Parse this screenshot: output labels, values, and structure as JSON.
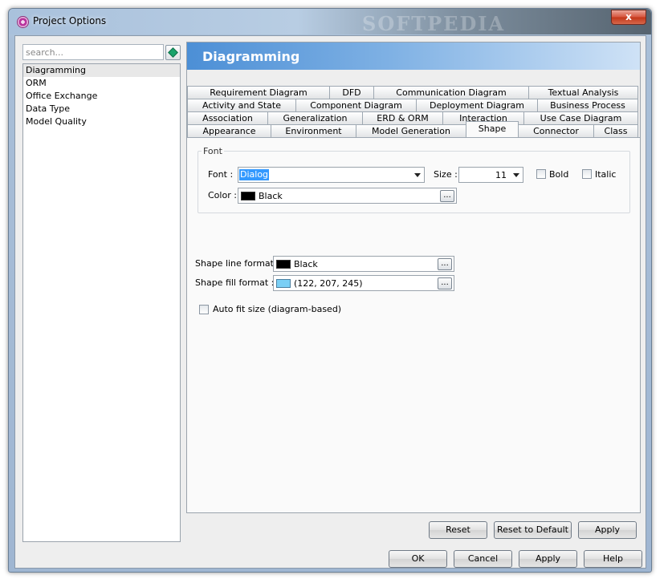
{
  "window": {
    "title": "Project Options",
    "watermark": "SOFTPEDIA",
    "close_label": "x"
  },
  "search": {
    "placeholder": "search..."
  },
  "nav": {
    "items": [
      "Diagramming",
      "ORM",
      "Office Exchange",
      "Data Type",
      "Model Quality"
    ],
    "selected": "Diagramming"
  },
  "header": {
    "title": "Diagramming"
  },
  "tabs": {
    "row1": [
      "Requirement Diagram",
      "DFD",
      "Communication Diagram",
      "Textual Analysis"
    ],
    "row2": [
      "Activity and State",
      "Component Diagram",
      "Deployment Diagram",
      "Business Process"
    ],
    "row3": [
      "Association",
      "Generalization",
      "ERD & ORM",
      "Interaction",
      "Use Case Diagram"
    ],
    "row4": [
      "Appearance",
      "Environment",
      "Model Generation",
      "Shape",
      "Connector",
      "Class"
    ],
    "active": "Shape"
  },
  "font_group": {
    "legend": "Font",
    "font_label": "Font :",
    "font_value": "Dialog",
    "size_label": "Size :",
    "size_value": "11",
    "bold_label": "Bold",
    "bold_checked": false,
    "italic_label": "Italic",
    "italic_checked": false,
    "color_label": "Color :",
    "color_value": "Black",
    "color_hex": "#000000"
  },
  "shape": {
    "line_label": "Shape line format :",
    "line_value": "Black",
    "line_hex": "#000000",
    "fill_label": "Shape fill format :",
    "fill_value": "(122, 207, 245)",
    "fill_hex": "#7acff5",
    "autofit_label": "Auto fit size (diagram-based)",
    "autofit_checked": false
  },
  "dots_label": "...",
  "panel_buttons": {
    "reset": "Reset",
    "reset_default": "Reset to Default",
    "apply": "Apply"
  },
  "dialog_buttons": {
    "ok": "OK",
    "cancel": "Cancel",
    "apply": "Apply",
    "help": "Help"
  }
}
